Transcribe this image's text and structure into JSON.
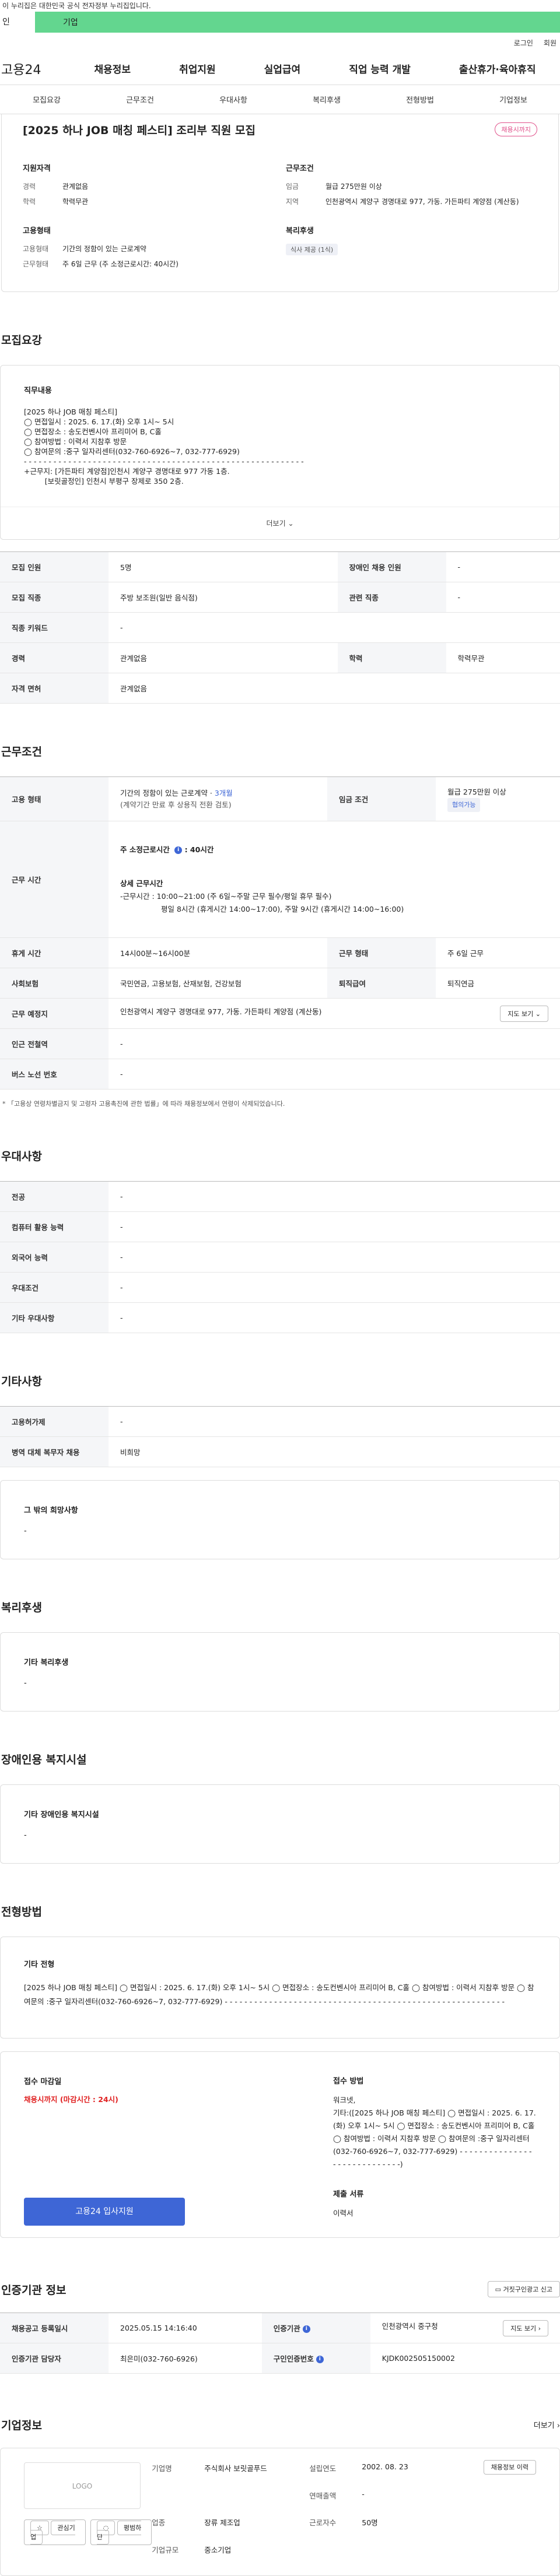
{
  "top": {
    "gov_notice": "이 누리집은 대한민국 공식 전자정부 누리집입니다.",
    "sub_a": "인",
    "sub_b": "기업"
  },
  "util": {
    "login": "로그인",
    "join": "회원"
  },
  "gnb": {
    "logo": "고용24",
    "menu": [
      "채용정보",
      "취업지원",
      "실업급여",
      "직업 능력 개발",
      "출산휴가·육아휴직"
    ]
  },
  "tabs": [
    "모집요강",
    "근무조건",
    "우대사항",
    "복리후생",
    "전형방법",
    "기업정보"
  ],
  "summary": {
    "title": "[2025 하나 JOB 매칭 페스티] 조리부 직원 모집",
    "badge": "채용시까지",
    "req_h": "지원자격",
    "career_k": "경력",
    "career_v": "관계없음",
    "edu_k": "학력",
    "edu_v": "학력무관",
    "emp_h": "고용형태",
    "emp_k": "고용형태",
    "emp_v": "기간의 정함이 있는 근로계약",
    "work_k": "근무형태",
    "work_v": "주 6일 근무 (주 소정근로시간: 40시간)",
    "cond_h": "근무조건",
    "wage_k": "임금",
    "wage_v": "월급 275만원 이상",
    "loc_k": "지역",
    "loc_v": "인천광역시 계양구 경명대로 977, 가동. 가든파티 계양점 (계산동)",
    "welfare_h": "복리후생",
    "welfare_v": "식사 제공 (1식)"
  },
  "recruit": {
    "section": "모집요강",
    "detail_label": "직무내용",
    "detail_text": "[2025 하나 JOB 매칭 페스티]\n◯ 면접일시 : 2025. 6. 17.(화) 오후 1시~ 5시\n◯ 면접장소 : 송도컨벤시아 프리미어 B, C홀\n◯ 참여방법 : 이력서 지참후 방문\n◯ 참여문의 :중구 일자리센터(032-760-6926~7, 032-777-6929)\n- - - - - - - - - - - - - - - - - - - - - - - - - - - - - - - - - - - - - - - - - - - - - - - - - - - - - - - - -\n+근무지: [가든파티 계양점]인천시 계양구 경명대로 977 가동 1층.\n         [보릿골정인] 인천시 부평구 장제로 350 2층.",
    "more": "더보기",
    "rows": [
      {
        "k1": "모집 인원",
        "v1": "5명",
        "k2": "장애인 채용 인원",
        "v2": "-"
      },
      {
        "k1": "모집 직종",
        "v1": "주방 보조원(일반 음식점)",
        "k2": "관련 직종",
        "v2": "-"
      },
      {
        "k1": "직종 키워드",
        "v1": "-",
        "k2": "",
        "v2": ""
      },
      {
        "k1": "경력",
        "v1": "관계없음",
        "k2": "학력",
        "v2": "학력무관"
      },
      {
        "k1": "자격 면허",
        "v1": "관계없음",
        "k2": "",
        "v2": ""
      }
    ]
  },
  "workcond": {
    "section": "근무조건",
    "emp_k": "고용 형태",
    "emp_v1": "기간의 정함이 있는 근로계약 · ",
    "emp_v1b": "3개월",
    "emp_v2": "(계약기간 만료 후 상용직 전환 검토)",
    "wage_k": "임금 조건",
    "wage_v": "월급 275만원 이상",
    "wage_pill": "협의가능",
    "hours_k": "근무 시간",
    "hours_week": "주 소정근로시간",
    "hours_week_v": ": 40시간",
    "hours_detail_h": "상세 근무시간",
    "hours_detail_1": "-근무시간 : 10:00~21:00 (주 6일~주말 근무 필수/평일 휴무 필수)",
    "hours_detail_2": "평일 8시간 (휴게시간 14:00~17:00), 주말 9시간 (휴게시간 14:00~16:00)",
    "break_k": "휴게 시간",
    "break_v": "14시00분~16시00분",
    "form_k": "근무 형태",
    "form_v": "주 6일 근무",
    "ins_k": "사회보험",
    "ins_v": "국민연금, 고용보험, 산재보험, 건강보험",
    "ret_k": "퇴직급여",
    "ret_v": "퇴직연금",
    "place_k": "근무 예정지",
    "place_v": "인천광역시 계양구 경명대로 977, 가동. 가든파티 계양점 (계산동)",
    "map_btn": "지도 보기",
    "subway_k": "인근 전철역",
    "subway_v": "-",
    "bus_k": "버스 노선 번호",
    "bus_v": "-",
    "note": "* 「고용상 연령차별금지 및 고령자 고용촉진에 관한 법률」에 따라 채용정보에서 연령이 삭제되었습니다."
  },
  "pref": {
    "section": "우대사항",
    "rows": [
      {
        "k": "전공",
        "v": "-"
      },
      {
        "k": "컴퓨터 활용 능력",
        "v": "-"
      },
      {
        "k": "외국어 능력",
        "v": "-"
      },
      {
        "k": "우대조건",
        "v": "-"
      },
      {
        "k": "기타 우대사항",
        "v": "-"
      }
    ]
  },
  "etc": {
    "section": "기타사항",
    "rows": [
      {
        "k": "고용허가제",
        "v": "-"
      },
      {
        "k": "병역 대체 복무자 채용",
        "v": "비희망"
      }
    ],
    "other_label": "그 밖의 희망사항",
    "other_v": "-"
  },
  "welfare": {
    "section": "복리후생",
    "label": "기타 복리후생",
    "v": "-"
  },
  "disab": {
    "section": "장애인용 복지시설",
    "label": "기타 장애인용 복지시설",
    "v": "-"
  },
  "select": {
    "section": "전형방법",
    "label": "기타 전형",
    "text": "[2025 하나 JOB 매칭 페스티] ◯ 면접일시 : 2025. 6. 17.(화) 오후 1시~ 5시 ◯ 면접장소 : 송도컨벤시아 프리미어 B, C홀 ◯ 참여방법 : 이력서 지참후 방문 ◯ 참여문의 :중구 일자리센터(032-760-6926~7, 032-777-6929) - - - - - - - - - - - - - - - - - - - - - - - - - - - - - - - - - - - - - - - - - - - - - - - - - - - - - - - - -"
  },
  "apply": {
    "deadline_h": "접수 마감일",
    "deadline_v": "채용시까지 (마감시간 : 24시)",
    "method_h": "접수 방법",
    "method_1": "워크넷,",
    "method_2": "기타:([2025 하나 JOB 매칭 페스티] ◯ 면접일시 : 2025. 6. 17.(화) 오후 1시~ 5시 ◯ 면접장소 : 송도컨벤시아 프리미어 B, C홀 ◯ 참여방법 : 이력서 지참후 방문 ◯ 참여문의 :중구 일자리센터(032-760-6926~7, 032-777-6929) - - - - - - - - - - - - - - - - - - - - - - - - - - - - -)",
    "docs_h": "제출 서류",
    "docs_v": "이력서",
    "btn": "고용24 입사지원"
  },
  "agency": {
    "section": "인증기관 정보",
    "report_btn": "거짓구인광고 신고",
    "reg_k": "채용공고 등록일시",
    "reg_v": "2025.05.15 14:16:40",
    "org_k": "인증기관",
    "org_v": "인천광역시 중구청",
    "org_btn": "지도 보기",
    "staff_k": "인증기관 담당자",
    "staff_v": "최은미(032-760-6926)",
    "id_k": "구인인증번호",
    "id_v": "KJDK002505150002"
  },
  "company": {
    "section": "기업정보",
    "more": "더보기",
    "logo": "LOGO",
    "fav_btn": "관심기업",
    "rate_btn": "평범하단",
    "rows": [
      {
        "k": "기업명",
        "v": "주식회사 보릿골푸드"
      },
      {
        "k": "설립연도",
        "v": "2002. 08. 23"
      },
      {
        "k": "연매출액",
        "v": "-"
      },
      {
        "k": "업종",
        "v": "장류 제조업"
      },
      {
        "k": "근로자수",
        "v": "50명"
      },
      {
        "k": "기업규모",
        "v": "중소기업"
      }
    ],
    "web_btn": "채용정보 이력"
  }
}
